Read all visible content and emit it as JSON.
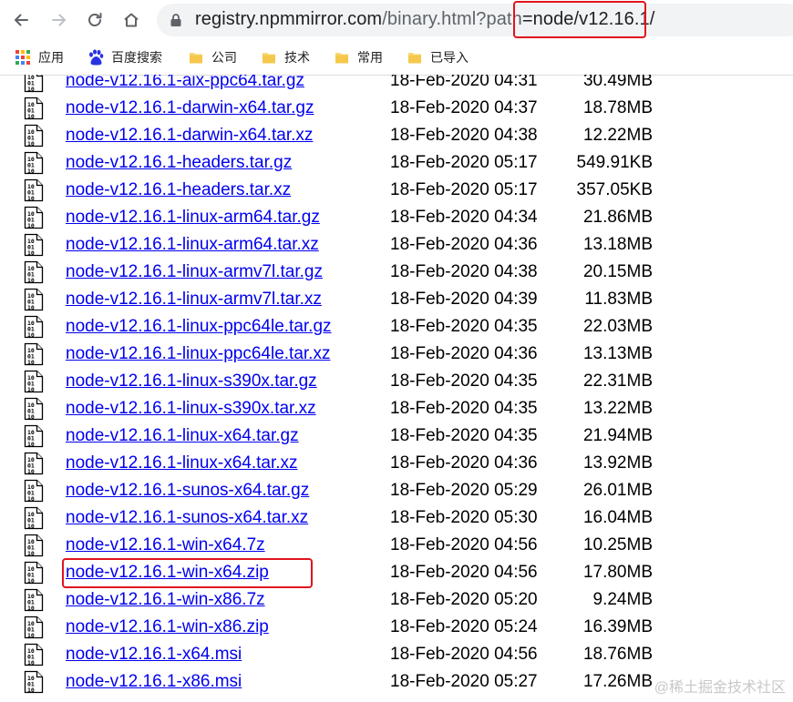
{
  "browser": {
    "url_host": "registry.npmmirror.com",
    "url_path_prefix": "/binary.html?path",
    "url_path_highlight": "=node/v12.16.1/"
  },
  "bookmarks": [
    {
      "label": "应用",
      "icon": "apps-grid-icon"
    },
    {
      "label": "百度搜索",
      "icon": "baidu-paw-icon"
    },
    {
      "label": "公司",
      "icon": "folder-icon"
    },
    {
      "label": "技术",
      "icon": "folder-icon"
    },
    {
      "label": "常用",
      "icon": "folder-icon"
    },
    {
      "label": "已导入",
      "icon": "folder-icon"
    }
  ],
  "files": [
    {
      "name": "node-v12.16.1-aix-ppc64.tar.gz",
      "date": "18-Feb-2020 04:31",
      "size": "30.49MB"
    },
    {
      "name": "node-v12.16.1-darwin-x64.tar.gz",
      "date": "18-Feb-2020 04:37",
      "size": "18.78MB"
    },
    {
      "name": "node-v12.16.1-darwin-x64.tar.xz",
      "date": "18-Feb-2020 04:38",
      "size": "12.22MB"
    },
    {
      "name": "node-v12.16.1-headers.tar.gz",
      "date": "18-Feb-2020 05:17",
      "size": "549.91KB"
    },
    {
      "name": "node-v12.16.1-headers.tar.xz",
      "date": "18-Feb-2020 05:17",
      "size": "357.05KB"
    },
    {
      "name": "node-v12.16.1-linux-arm64.tar.gz",
      "date": "18-Feb-2020 04:34",
      "size": "21.86MB"
    },
    {
      "name": "node-v12.16.1-linux-arm64.tar.xz",
      "date": "18-Feb-2020 04:36",
      "size": "13.18MB"
    },
    {
      "name": "node-v12.16.1-linux-armv7l.tar.gz",
      "date": "18-Feb-2020 04:38",
      "size": "20.15MB"
    },
    {
      "name": "node-v12.16.1-linux-armv7l.tar.xz",
      "date": "18-Feb-2020 04:39",
      "size": "11.83MB"
    },
    {
      "name": "node-v12.16.1-linux-ppc64le.tar.gz",
      "date": "18-Feb-2020 04:35",
      "size": "22.03MB"
    },
    {
      "name": "node-v12.16.1-linux-ppc64le.tar.xz",
      "date": "18-Feb-2020 04:36",
      "size": "13.13MB"
    },
    {
      "name": "node-v12.16.1-linux-s390x.tar.gz",
      "date": "18-Feb-2020 04:35",
      "size": "22.31MB"
    },
    {
      "name": "node-v12.16.1-linux-s390x.tar.xz",
      "date": "18-Feb-2020 04:35",
      "size": "13.22MB"
    },
    {
      "name": "node-v12.16.1-linux-x64.tar.gz",
      "date": "18-Feb-2020 04:35",
      "size": "21.94MB"
    },
    {
      "name": "node-v12.16.1-linux-x64.tar.xz",
      "date": "18-Feb-2020 04:36",
      "size": "13.92MB"
    },
    {
      "name": "node-v12.16.1-sunos-x64.tar.gz",
      "date": "18-Feb-2020 05:29",
      "size": "26.01MB"
    },
    {
      "name": "node-v12.16.1-sunos-x64.tar.xz",
      "date": "18-Feb-2020 05:30",
      "size": "16.04MB"
    },
    {
      "name": "node-v12.16.1-win-x64.7z",
      "date": "18-Feb-2020 04:56",
      "size": "10.25MB"
    },
    {
      "name": "node-v12.16.1-win-x64.zip",
      "date": "18-Feb-2020 04:56",
      "size": "17.80MB",
      "highlighted": true
    },
    {
      "name": "node-v12.16.1-win-x86.7z",
      "date": "18-Feb-2020 05:20",
      "size": "9.24MB"
    },
    {
      "name": "node-v12.16.1-win-x86.zip",
      "date": "18-Feb-2020 05:24",
      "size": "16.39MB"
    },
    {
      "name": "node-v12.16.1-x64.msi",
      "date": "18-Feb-2020 04:56",
      "size": "18.76MB"
    },
    {
      "name": "node-v12.16.1-x86.msi",
      "date": "18-Feb-2020 05:27",
      "size": "17.26MB"
    }
  ],
  "watermark": "@稀土掘金技术社区",
  "colors": {
    "link": "#0000ee",
    "highlight_box": "#e0141e",
    "omnibox_bg": "#f1f3f4",
    "folder": "#f8d775"
  }
}
